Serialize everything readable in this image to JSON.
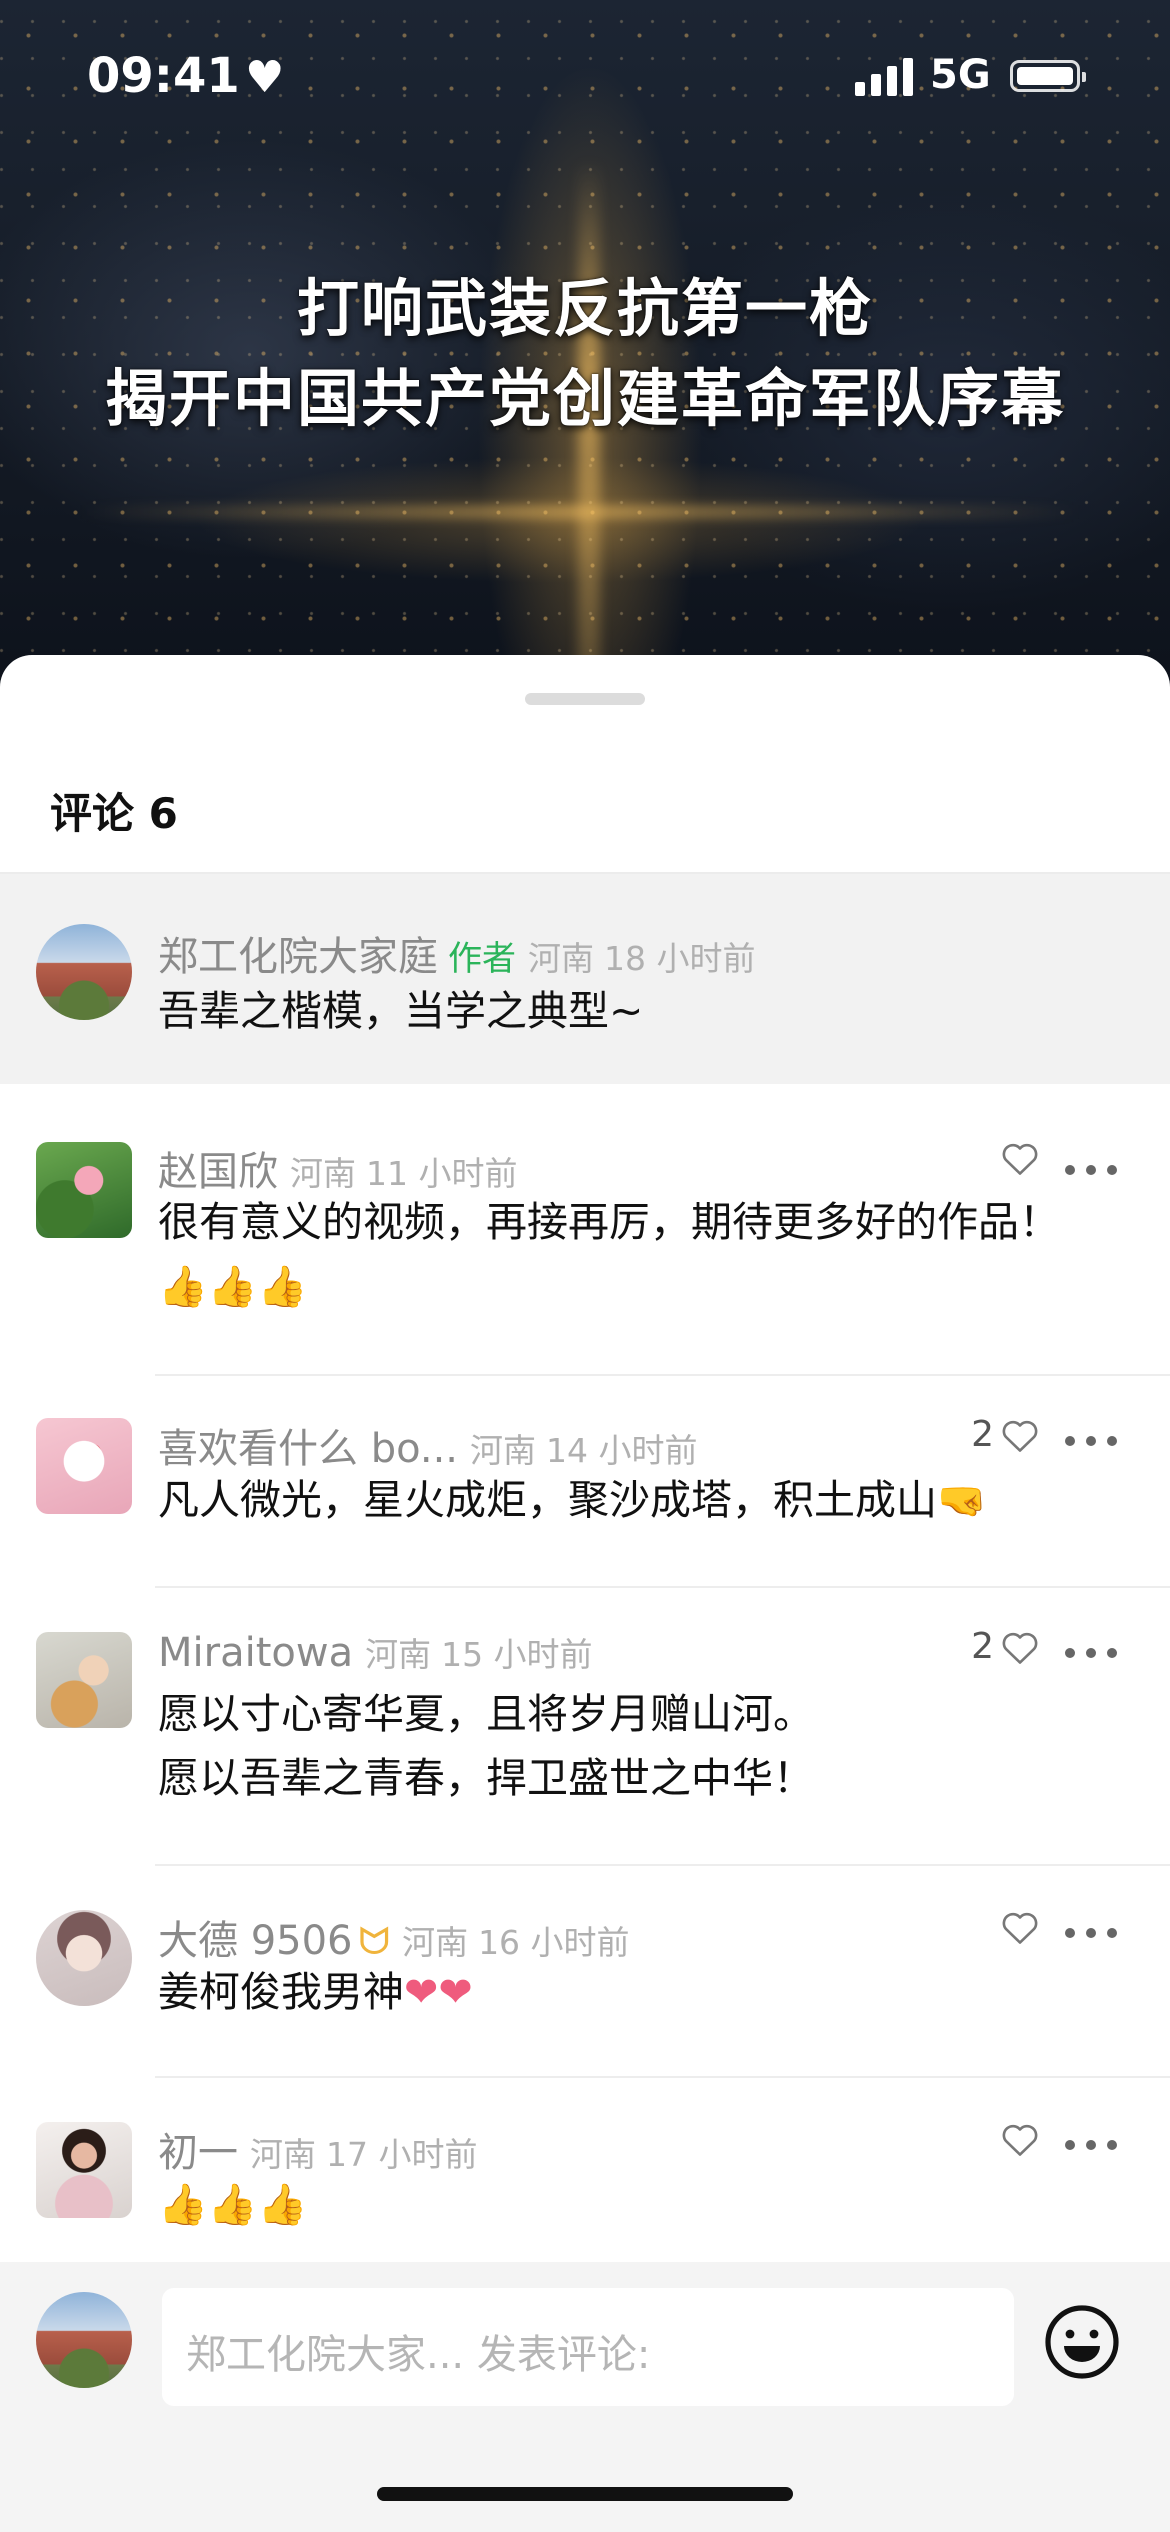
{
  "status_bar": {
    "time": "09:41",
    "network": "5G"
  },
  "video": {
    "title_line1": "打响武装反抗第一枪",
    "title_line2": "揭开中国共产党创建革命军队序幕"
  },
  "sheet": {
    "header": "评论 6"
  },
  "comments": [
    {
      "name": "郑工化院大家庭",
      "tag": "作者",
      "location": "河南",
      "time": "18 小时前",
      "text": "吾辈之楷模，当学之典型~",
      "likes": "",
      "pinned": true
    },
    {
      "name": "赵国欣",
      "location": "河南",
      "time": "11 小时前",
      "text": "很有意义的视频，再接再厉，期待更多好的作品！",
      "emoji": "👍👍👍",
      "likes": ""
    },
    {
      "name": "喜欢看什么 bo...",
      "location": "河南",
      "time": "14 小时前",
      "text": "凡人微光，星火成炬，聚沙成塔，积土成山",
      "emoji": "🤜",
      "likes": "2"
    },
    {
      "name": "Miraitowa",
      "location": "河南",
      "time": "15 小时前",
      "text_line1": "愿以寸心寄华夏，且将岁月赠山河。",
      "text_line2": "愿以吾辈之青春，捍卫盛世之中华！",
      "likes": "2"
    },
    {
      "name": "大德 9506",
      "location": "河南",
      "time": "16 小时前",
      "text": "姜柯俊我男神",
      "emoji": "❤❤",
      "likes": ""
    },
    {
      "name": "初一",
      "location": "河南",
      "time": "17 小时前",
      "emoji": "👍👍👍",
      "likes": ""
    }
  ],
  "input_bar": {
    "placeholder": "郑工化院大家... 发表评论:"
  },
  "icons": {
    "like": "heart-outline-icon",
    "more": "more-dots-icon",
    "emoji": "smiley-icon",
    "badge": "ribbon-badge-icon"
  },
  "colors": {
    "author_tag": "#2bb45a",
    "meta_gray": "#8a8a8a",
    "badge": "#f0b43c"
  }
}
